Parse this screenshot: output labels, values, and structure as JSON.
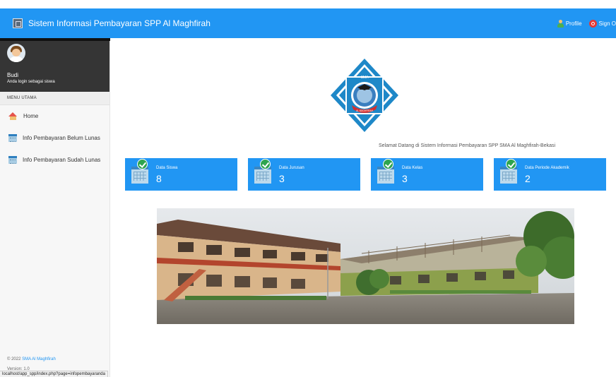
{
  "header": {
    "title": "Sistem Informasi Pembayaran SPP Al Maghfirah",
    "profile_label": "Profile",
    "signout_label": "Sign O"
  },
  "sidebar": {
    "user_name": "Budi",
    "user_role": "Anda login sebagai siswa",
    "menu_header": "MENU UTAMA",
    "items": [
      {
        "label": "Home",
        "icon": "home-icon"
      },
      {
        "label": "Info Pembayaran Belum Lunas",
        "icon": "calendar-icon"
      },
      {
        "label": "Info Pembayaran Sudah Lunas",
        "icon": "calendar-icon"
      }
    ],
    "footer_copy_prefix": "© 2022 ",
    "footer_copy_link": "SMA Al Maghfirah",
    "footer_version": "Version: 1.0"
  },
  "main": {
    "emblem_text_top": "SMA",
    "emblem_text_bottom": "AL MAGHFIRAH",
    "welcome": "Selamat Datang di Sistem Informasi Pembayaran SPP SMA Al Maghfirah-Bekasi",
    "cards": [
      {
        "label": "Data Siswa",
        "value": "8"
      },
      {
        "label": "Data Jurusan",
        "value": "3"
      },
      {
        "label": "Data Kelas",
        "value": "3"
      },
      {
        "label": "Data Periode Akademik",
        "value": "2"
      }
    ]
  },
  "status_url": "localhost/app_spp/index.php?page=infopembayaranda",
  "colors": {
    "primary": "#2196f3",
    "sidebar_profile_bg": "#353535",
    "check_green": "#2ea44f"
  }
}
